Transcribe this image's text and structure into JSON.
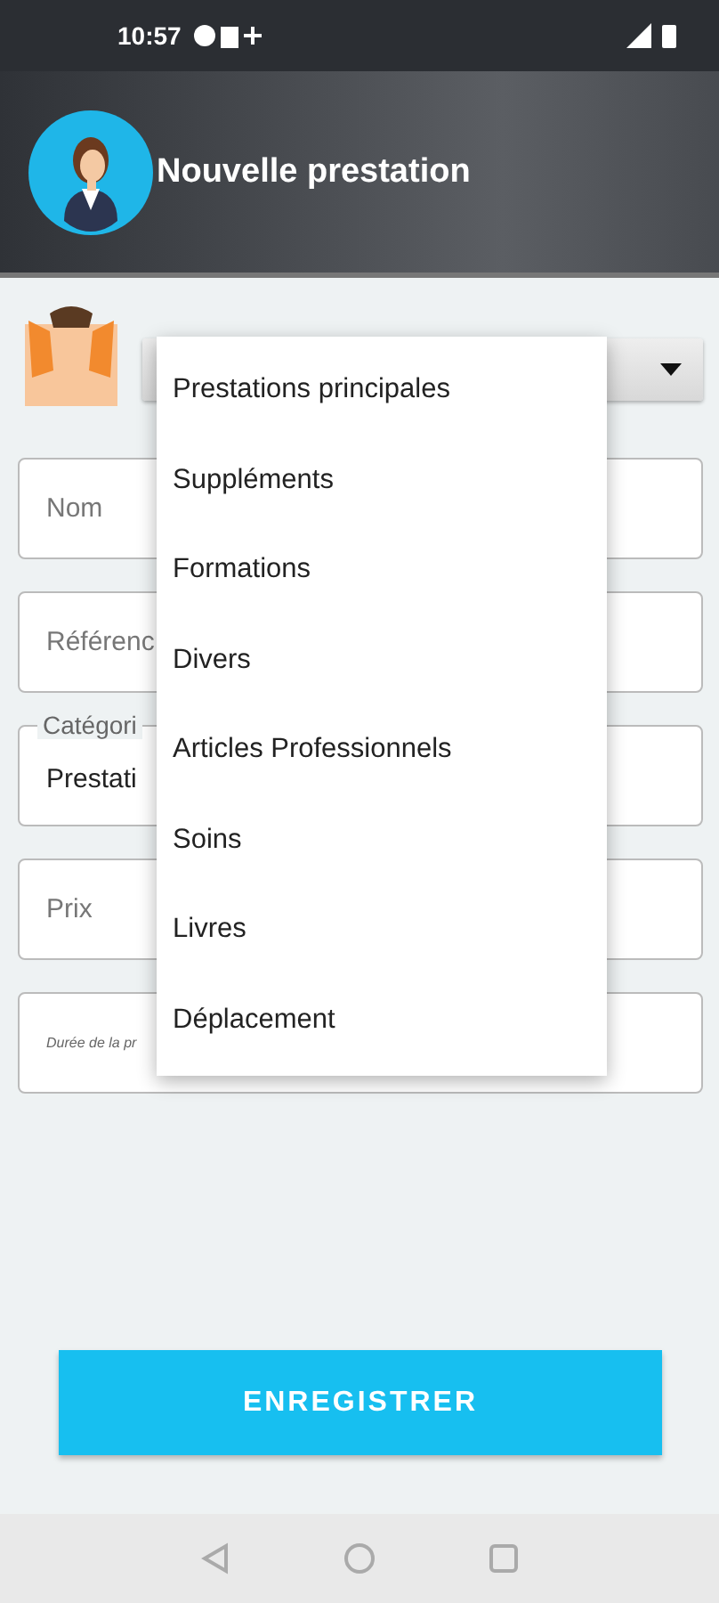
{
  "status_bar": {
    "time": "10:57"
  },
  "header": {
    "title": "Nouvelle prestation"
  },
  "form": {
    "fields": [
      {
        "kind": "input",
        "placeholder": "Nom"
      },
      {
        "kind": "input",
        "placeholder": "Référenc"
      },
      {
        "kind": "outlined",
        "label": "Catégori",
        "value": "Prestati"
      },
      {
        "kind": "input",
        "placeholder": "Prix"
      },
      {
        "kind": "small",
        "placeholder": "Durée de la pr"
      }
    ]
  },
  "dropdown_menu": {
    "items": [
      "Prestations principales",
      "Suppléments",
      "Formations",
      "Divers",
      "Articles Professionnels",
      "Soins",
      "Livres",
      "Déplacement"
    ]
  },
  "save_button": {
    "label": "ENREGISTRER"
  }
}
